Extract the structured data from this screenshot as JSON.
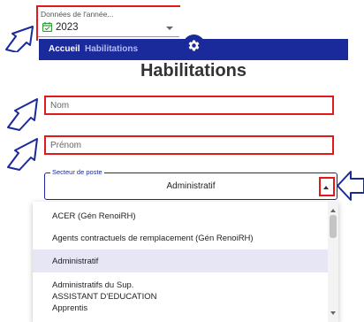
{
  "year_selector": {
    "label": "Données de l'année...",
    "value": "2023"
  },
  "navbar": {
    "home": "Accueil",
    "habilitations": "Habilitations"
  },
  "page_title": "Habilitations",
  "fields": {
    "nom_placeholder": "Nom",
    "prenom_placeholder": "Prénom"
  },
  "secteur": {
    "label": "Secteur de poste",
    "value": "Administratif"
  },
  "options": [
    "ACER (Gén RenoiRH)",
    "Agents contractuels de remplacement (Gén RenoiRH)",
    "Administratif",
    "Administratifs du Sup.",
    "ASSISTANT D'EDUCATION",
    "Apprentis"
  ],
  "colors": {
    "accent": "#1a2a9a",
    "highlight": "#e0191b",
    "selected_option": "#e6e6f5"
  }
}
